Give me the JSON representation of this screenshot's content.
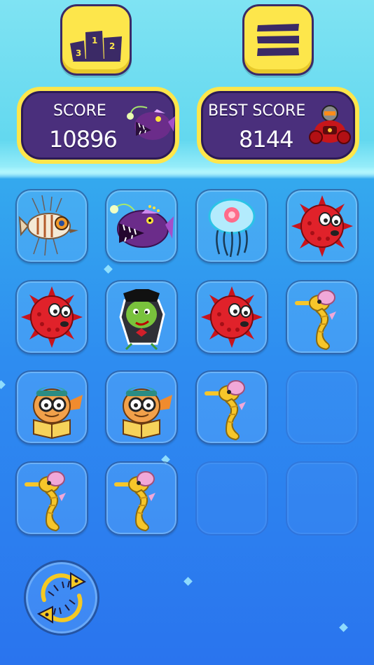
{
  "header": {
    "leaderboard_icon": "podium-icon",
    "menu_icon": "hamburger-menu-icon",
    "podium_numbers": [
      "3",
      "1",
      "2"
    ]
  },
  "score": {
    "label": "SCORE",
    "value": "10896",
    "creature": "anglerfish"
  },
  "best_score": {
    "label": "BEST SCORE",
    "value": "8144",
    "creature": "red-armored-robot"
  },
  "board": {
    "rows": [
      [
        "lionfish",
        "anglerfish",
        "jellyfish",
        "red-pufferfish"
      ],
      [
        "red-pufferfish",
        "green-gangster-fish",
        "red-pufferfish",
        "seahorse"
      ],
      [
        "scholar-fish",
        "scholar-fish",
        "seahorse",
        "empty"
      ],
      [
        "seahorse",
        "seahorse",
        "empty",
        "empty"
      ]
    ]
  },
  "controls": {
    "refresh_icon": "refresh-fishbone-arrows-icon"
  },
  "colors": {
    "accent": "#fde64b",
    "panel": "#4a2f7c",
    "water_top": "#63d8ef",
    "water_bottom": "#2a74ee"
  }
}
